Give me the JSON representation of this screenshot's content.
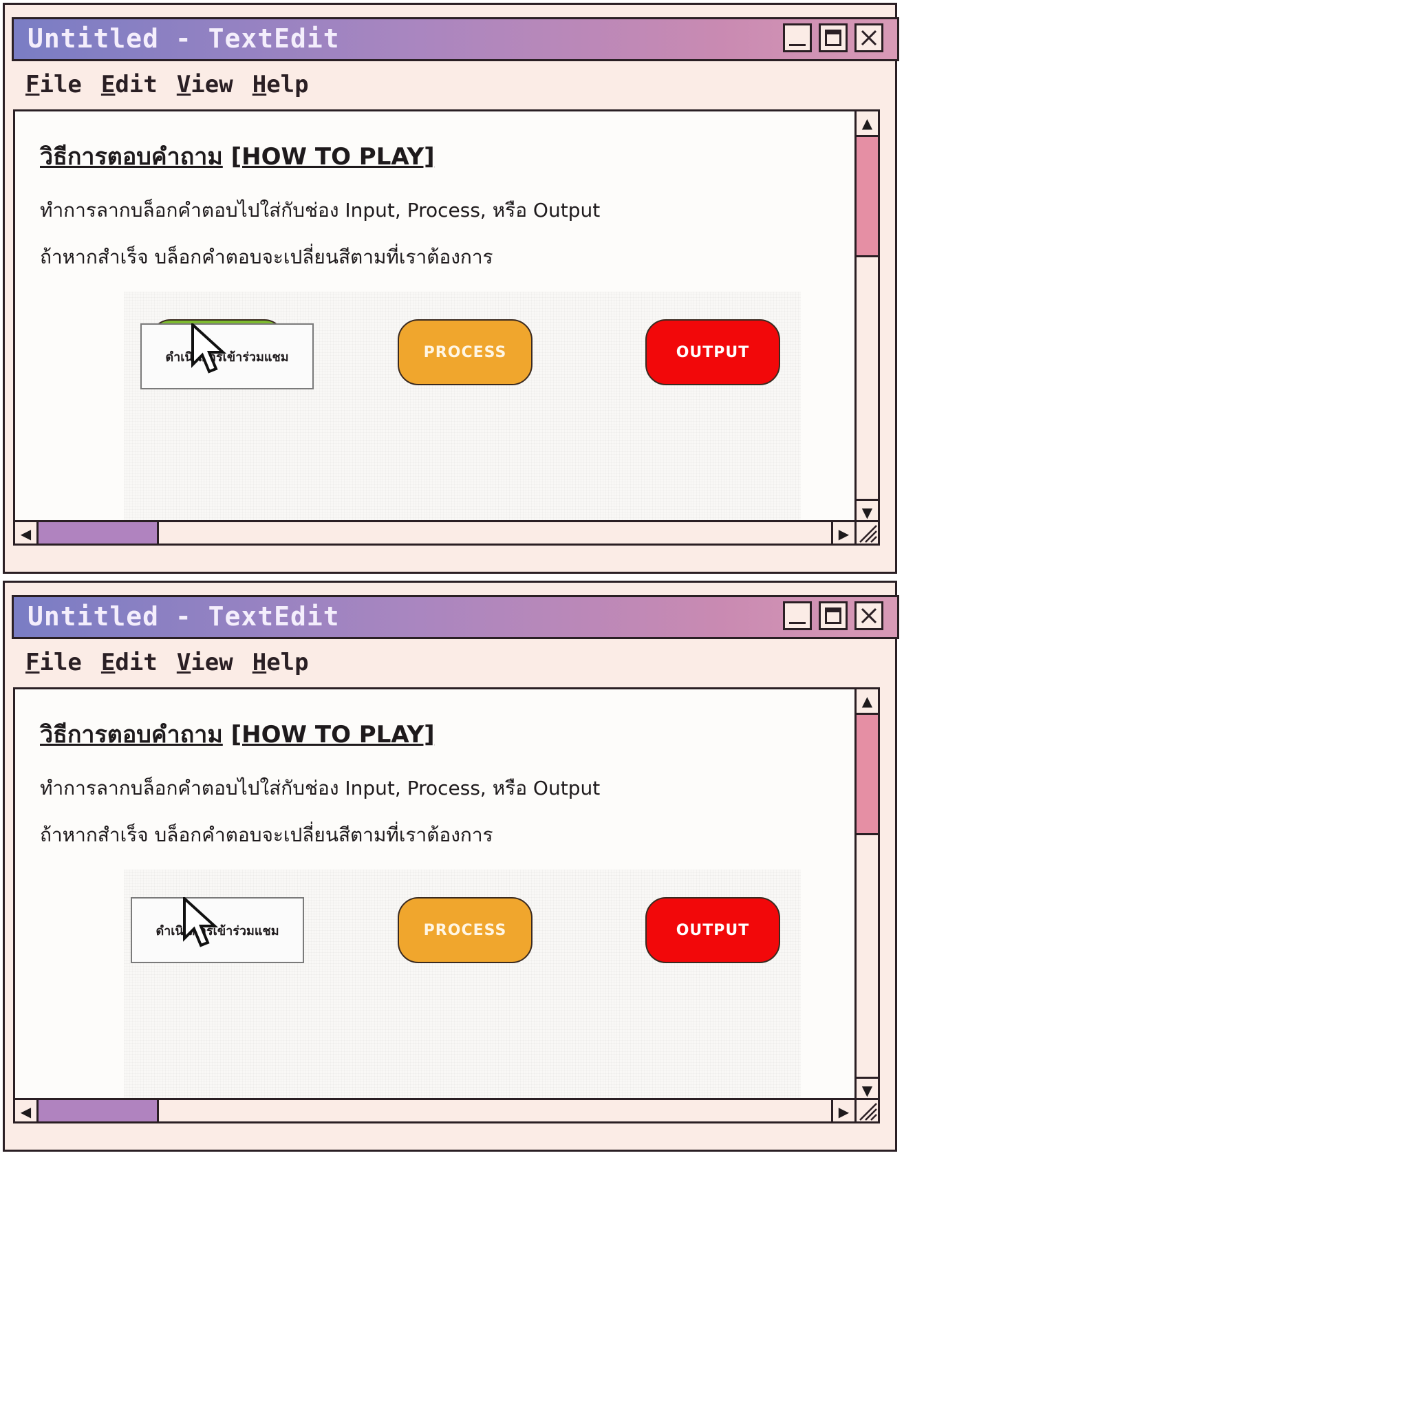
{
  "frames": [
    {
      "window": {
        "title": "Untitled - TextEdit",
        "menu": [
          {
            "first": "F",
            "rest": "ile"
          },
          {
            "first": "E",
            "rest": "dit"
          },
          {
            "first": "V",
            "rest": "iew"
          },
          {
            "first": "H",
            "rest": "elp"
          }
        ]
      },
      "content": {
        "heading_th": "วิธีการตอบคำถาม",
        "heading_en": "[HOW TO PLAY]",
        "line1": "ทำการลากบล็อกคำตอบไปใส่กับช่อง Input, Process, หรือ Output",
        "line2": "ถ้าหากสำเร็จ บล็อกคำตอบจะเปลี่ยนสีตามที่เราต้องการ"
      },
      "game": {
        "process_label": "PROCESS",
        "output_label": "OUTPUT",
        "drag_block_text": "ดำเนินการเข้าร่วมแชม"
      }
    },
    {
      "window": {
        "title": "Untitled - TextEdit",
        "menu": [
          {
            "first": "F",
            "rest": "ile"
          },
          {
            "first": "E",
            "rest": "dit"
          },
          {
            "first": "V",
            "rest": "iew"
          },
          {
            "first": "H",
            "rest": "elp"
          }
        ]
      },
      "content": {
        "heading_th": "วิธีการตอบคำถาม",
        "heading_en": "[HOW TO PLAY]",
        "line1": "ทำการลากบล็อกคำตอบไปใส่กับช่อง Input, Process, หรือ Output",
        "line2": "ถ้าหากสำเร็จ บล็อกคำตอบจะเปลี่ยนสีตามที่เราต้องการ"
      },
      "game": {
        "process_label": "PROCESS",
        "output_label": "OUTPUT",
        "drag_block_text": "ดำเนินการเข้าร่วมแชม"
      }
    }
  ],
  "colors": {
    "title_gradient": [
      "#7a7dc4",
      "#d89ab6"
    ],
    "window_bg": "#fbece6",
    "input_green": "#7dbb2f",
    "process_orange": "#f0a62d",
    "output_red": "#f2080a",
    "vscroll_thumb": "#e58fa4",
    "hscroll_thumb": "#b083bf"
  },
  "icons": {
    "minimize": "minimize-icon",
    "maximize": "maximize-icon",
    "close": "close-icon",
    "cursor": "arrow-cursor-icon",
    "scroll_up": "triangle-up-icon",
    "scroll_down": "triangle-down-icon",
    "scroll_left": "triangle-left-icon",
    "scroll_right": "triangle-right-icon",
    "resize_grip": "resize-grip-icon"
  }
}
